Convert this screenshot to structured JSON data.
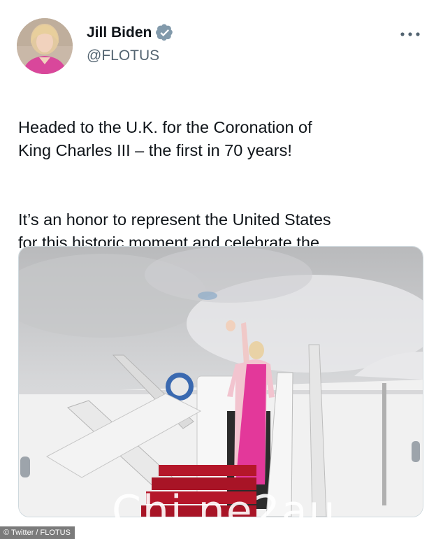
{
  "author": {
    "name": "Jill Biden",
    "handle": "@FLOTUS",
    "verified": true,
    "verified_color": "#829aab"
  },
  "tweet": {
    "paragraphs": [
      "Headed to the U.K. for the Coronation of\nKing Charles III – the first in 70 years!",
      "It’s an honor to represent the United States\nfor this historic moment and celebrate the\nspecial relationship between our countries."
    ]
  },
  "icons": {
    "more": "more-options-icon",
    "verified": "verified-badge-icon"
  },
  "overlay": {
    "watermark": "Chi ne2au",
    "credit": "© Twitter / FLOTUS"
  },
  "colors": {
    "text": "#0f1419",
    "secondary": "#536471",
    "carpet": "#b5172a",
    "outfit_pink": "#e3389a"
  }
}
